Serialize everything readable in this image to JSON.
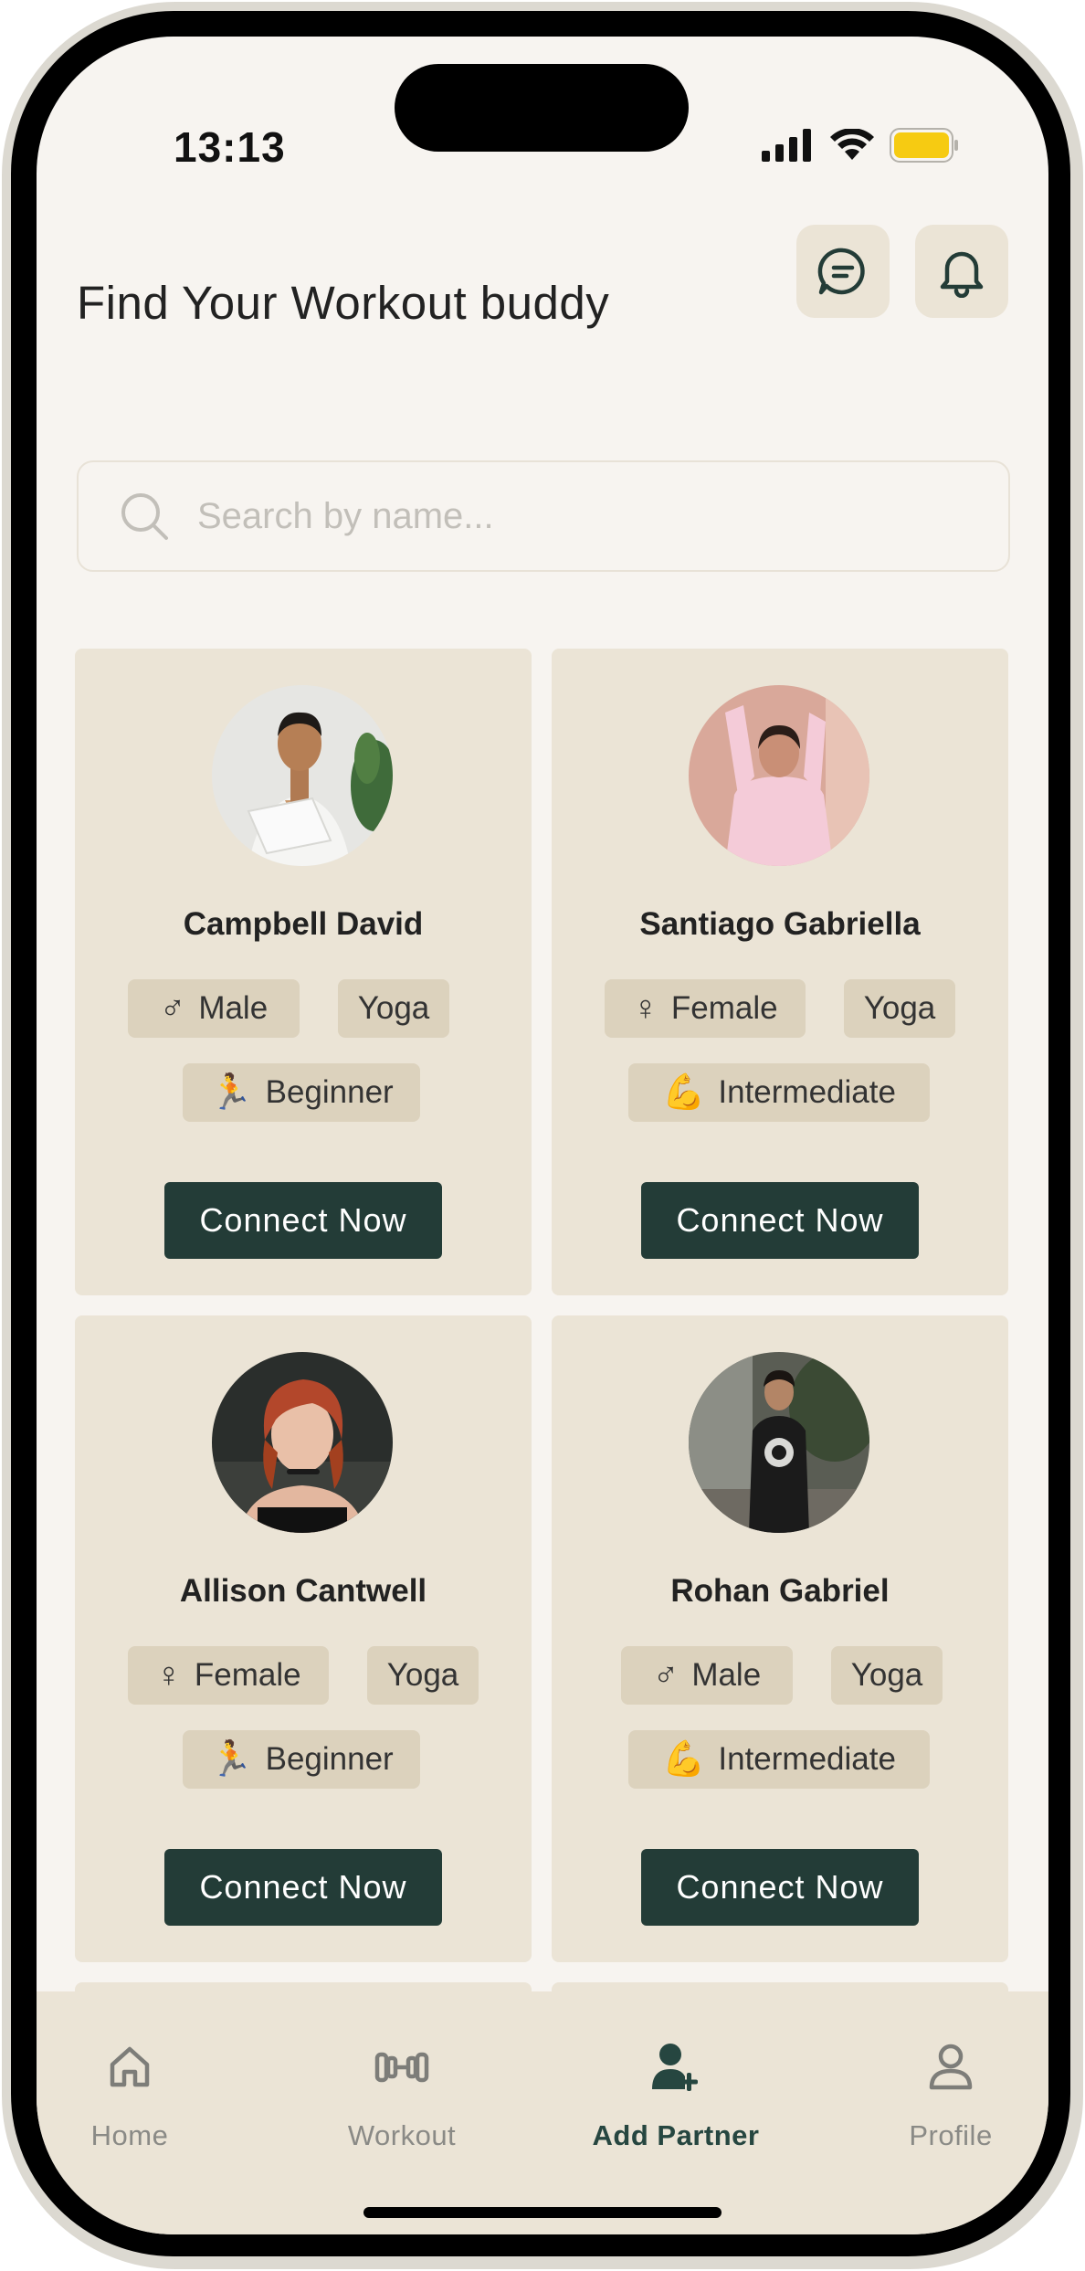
{
  "status_bar": {
    "time": "13:13"
  },
  "header": {
    "title": "Find Your Workout buddy"
  },
  "search": {
    "placeholder": "Search by name..."
  },
  "cards": [
    {
      "name": "Campbell David",
      "gender": "Male",
      "activity": "Yoga",
      "level": "Beginner",
      "button": "Connect Now"
    },
    {
      "name": "Santiago Gabriella",
      "gender": "Female",
      "activity": "Yoga",
      "level": "Intermediate",
      "button": "Connect Now"
    },
    {
      "name": "Allison Cantwell",
      "gender": "Female",
      "activity": "Yoga",
      "level": "Beginner",
      "button": "Connect Now"
    },
    {
      "name": "Rohan Gabriel",
      "gender": "Male",
      "activity": "Yoga",
      "level": "Intermediate",
      "button": "Connect Now"
    }
  ],
  "tabbar": {
    "items": [
      {
        "label": "Home",
        "icon": "home-icon"
      },
      {
        "label": "Workout",
        "icon": "dumbbell-icon"
      },
      {
        "label": "Add Partner",
        "icon": "add-user-icon",
        "active": true
      },
      {
        "label": "Profile",
        "icon": "user-icon"
      }
    ]
  },
  "colors": {
    "accent": "#233c37",
    "card": "#ebe4d6",
    "tag": "#dcd2bd",
    "background": "#f7f4f0"
  }
}
